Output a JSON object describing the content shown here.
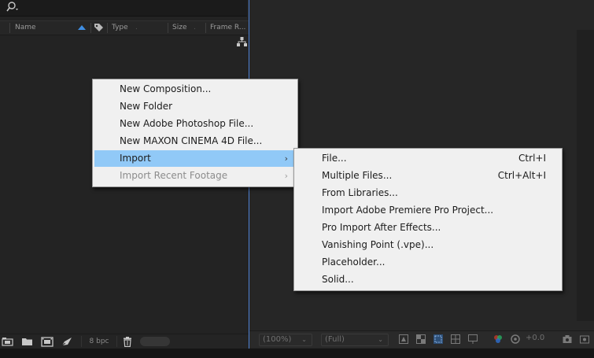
{
  "project_panel": {
    "columns": {
      "name": "Name",
      "type": "Type",
      "size": "Size",
      "frame_rate": "Frame R..."
    },
    "footer": {
      "bit_depth": "8 bpc"
    }
  },
  "context_menu": {
    "items": [
      {
        "label": "New Composition...",
        "state": "normal"
      },
      {
        "label": "New Folder",
        "state": "normal"
      },
      {
        "label": "New Adobe Photoshop File...",
        "state": "normal"
      },
      {
        "label": "New MAXON CINEMA 4D File...",
        "state": "normal"
      },
      {
        "label": "Import",
        "state": "highlighted",
        "submenu": true,
        "arrow": "›"
      },
      {
        "label": "Import Recent Footage",
        "state": "disabled",
        "submenu": true,
        "arrow": "›"
      }
    ]
  },
  "import_submenu": {
    "items": [
      {
        "label": "File...",
        "shortcut": "Ctrl+I"
      },
      {
        "label": "Multiple Files...",
        "shortcut": "Ctrl+Alt+I"
      },
      {
        "label": "From Libraries..."
      },
      {
        "label": "Import Adobe Premiere Pro Project..."
      },
      {
        "label": "Pro Import After Effects..."
      },
      {
        "label": "Vanishing Point (.vpe)..."
      },
      {
        "label": "Placeholder..."
      },
      {
        "label": "Solid..."
      }
    ]
  },
  "viewer_toolbar": {
    "zoom": "(100%)",
    "resolution": "(Full)",
    "exposure": "+0.0"
  },
  "colors": {
    "highlight": "#91c9f7",
    "panel_focus_border": "#4f83d6",
    "menu_background": "#f0f0f0"
  }
}
